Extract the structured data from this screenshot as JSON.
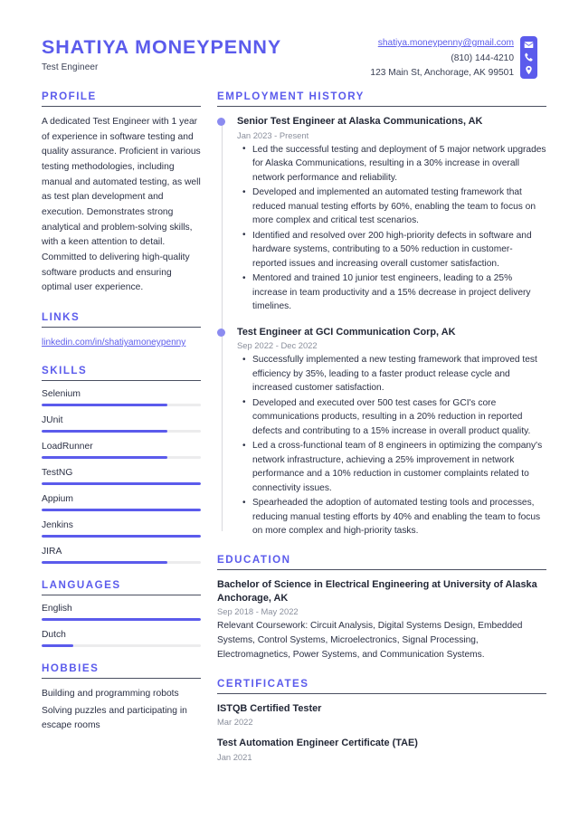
{
  "header": {
    "full_name": "SHATIYA MONEYPENNY",
    "job_title": "Test Engineer",
    "email": "shatiya.moneypenny@gmail.com",
    "phone": "(810) 144-4210",
    "address": "123 Main St, Anchorage, AK 99501",
    "icons": [
      "envelope-icon",
      "phone-icon",
      "location-pin-icon"
    ],
    "accent_color": "#5B5BEC"
  },
  "profile": {
    "heading": "PROFILE",
    "text": "A dedicated Test Engineer with 1 year of experience in software testing and quality assurance. Proficient in various testing methodologies, including manual and automated testing, as well as test plan development and execution. Demonstrates strong analytical and problem-solving skills, with a keen attention to detail. Committed to delivering high-quality software products and ensuring optimal user experience."
  },
  "links": {
    "heading": "LINKS",
    "items": [
      {
        "label": "linkedin.com/in/shatiyamoneypenny"
      }
    ]
  },
  "skills": {
    "heading": "SKILLS",
    "items": [
      {
        "label": "Selenium",
        "level": 79
      },
      {
        "label": "JUnit",
        "level": 79
      },
      {
        "label": "LoadRunner",
        "level": 79
      },
      {
        "label": "TestNG",
        "level": 100
      },
      {
        "label": "Appium",
        "level": 100
      },
      {
        "label": "Jenkins",
        "level": 100
      },
      {
        "label": "JIRA",
        "level": 79
      }
    ]
  },
  "languages": {
    "heading": "LANGUAGES",
    "items": [
      {
        "label": "English",
        "level": 100
      },
      {
        "label": "Dutch",
        "level": 20
      }
    ]
  },
  "hobbies": {
    "heading": "HOBBIES",
    "items": [
      "Building and programming robots",
      "Solving puzzles and participating in escape rooms"
    ]
  },
  "employment": {
    "heading": "EMPLOYMENT HISTORY",
    "jobs": [
      {
        "title": "Senior Test Engineer at Alaska Communications, AK",
        "date": "Jan 2023 - Present",
        "bullets": [
          "Led the successful testing and deployment of 5 major network upgrades for Alaska Communications, resulting in a 30% increase in overall network performance and reliability.",
          "Developed and implemented an automated testing framework that reduced manual testing efforts by 60%, enabling the team to focus on more complex and critical test scenarios.",
          "Identified and resolved over 200 high-priority defects in software and hardware systems, contributing to a 50% reduction in customer-reported issues and increasing overall customer satisfaction.",
          "Mentored and trained 10 junior test engineers, leading to a 25% increase in team productivity and a 15% decrease in project delivery timelines."
        ]
      },
      {
        "title": "Test Engineer at GCI Communication Corp, AK",
        "date": "Sep 2022 - Dec 2022",
        "bullets": [
          "Successfully implemented a new testing framework that improved test efficiency by 35%, leading to a faster product release cycle and increased customer satisfaction.",
          "Developed and executed over 500 test cases for GCI's core communications products, resulting in a 20% reduction in reported defects and contributing to a 15% increase in overall product quality.",
          "Led a cross-functional team of 8 engineers in optimizing the company's network infrastructure, achieving a 25% improvement in network performance and a 10% reduction in customer complaints related to connectivity issues.",
          "Spearheaded the adoption of automated testing tools and processes, reducing manual testing efforts by 40% and enabling the team to focus on more complex and high-priority tasks."
        ]
      }
    ]
  },
  "education": {
    "heading": "EDUCATION",
    "entries": [
      {
        "title": "Bachelor of Science in Electrical Engineering at University of Alaska Anchorage, AK",
        "date": "Sep 2018 - May 2022",
        "description": "Relevant Coursework: Circuit Analysis, Digital Systems Design, Embedded Systems, Control Systems, Microelectronics, Signal Processing, Electromagnetics, Power Systems, and Communication Systems."
      }
    ]
  },
  "certificates": {
    "heading": "CERTIFICATES",
    "entries": [
      {
        "title": "ISTQB Certified Tester",
        "date": "Mar 2022"
      },
      {
        "title": "Test Automation Engineer Certificate (TAE)",
        "date": "Jan 2021"
      }
    ]
  }
}
